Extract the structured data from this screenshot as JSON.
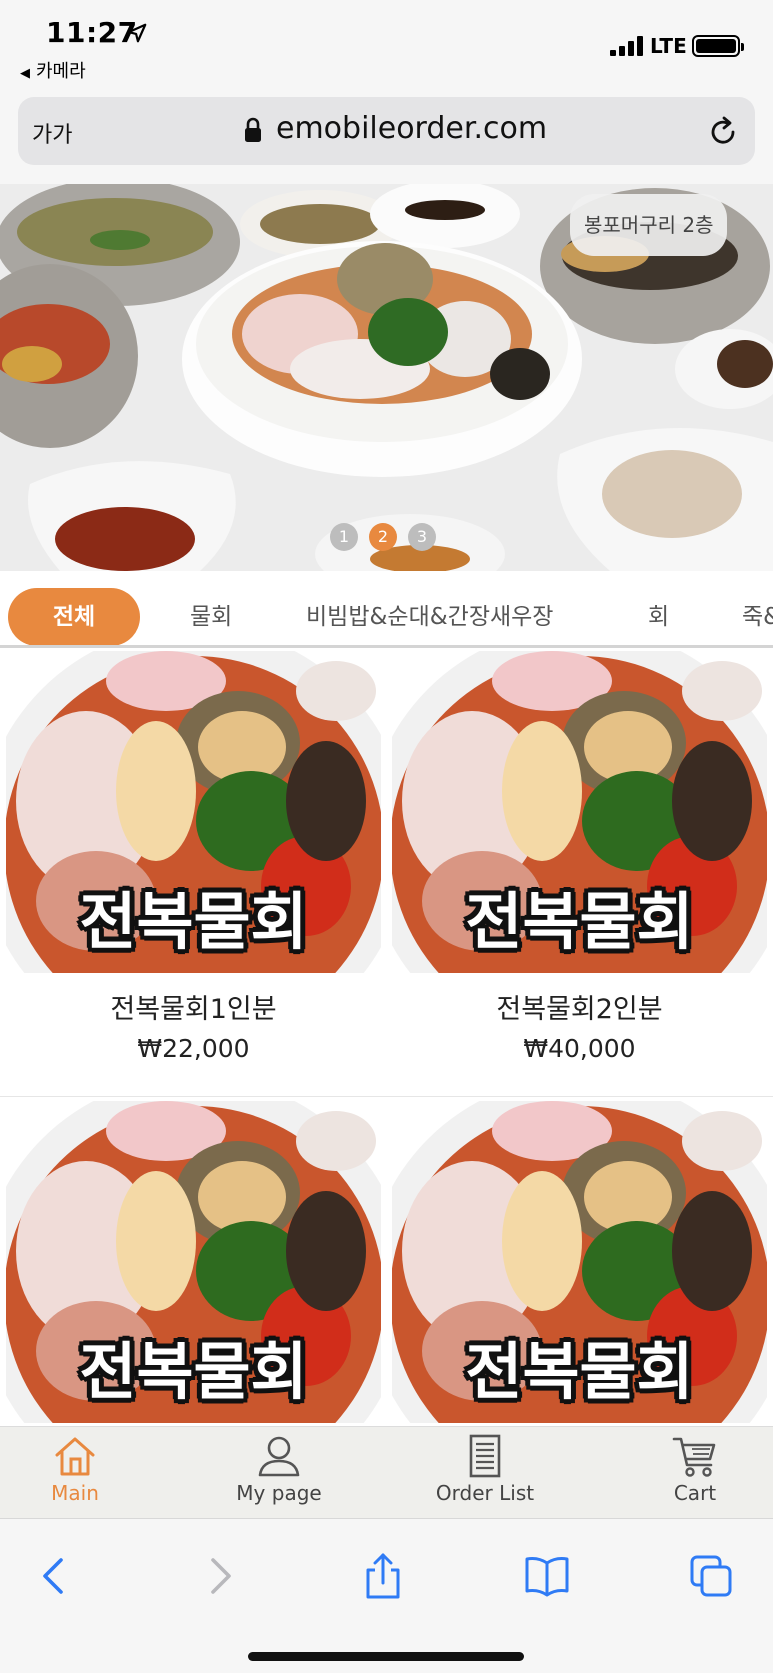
{
  "status_bar": {
    "time": "11:27",
    "back_app_label": "카메라",
    "network": "LTE"
  },
  "browser": {
    "text_size_button": "가가",
    "url": "emobileorder.com"
  },
  "hero": {
    "store_badge": "봉포머구리 2층",
    "pages": [
      "1",
      "2",
      "3"
    ],
    "active_page": 2
  },
  "categories": {
    "items": [
      "전체",
      "물회",
      "비빔밥&순대&간장새우장",
      "회",
      "죽&"
    ],
    "active": "전체"
  },
  "products": [
    {
      "image_caption": "전복물회",
      "name": "전복물회1인분",
      "price": "₩22,000"
    },
    {
      "image_caption": "전복물회",
      "name": "전복물회2인분",
      "price": "₩40,000"
    },
    {
      "image_caption": "전복물회",
      "name": "",
      "price": ""
    },
    {
      "image_caption": "전복물회",
      "name": "",
      "price": ""
    }
  ],
  "app_nav": {
    "items": [
      {
        "label": "Main",
        "icon": "home-icon",
        "active": true
      },
      {
        "label": "My page",
        "icon": "user-icon",
        "active": false
      },
      {
        "label": "Order List",
        "icon": "list-icon",
        "active": false
      },
      {
        "label": "Cart",
        "icon": "cart-icon",
        "active": false
      }
    ]
  },
  "colors": {
    "accent": "#e8893f",
    "safari_blue": "#2f7bf5"
  }
}
